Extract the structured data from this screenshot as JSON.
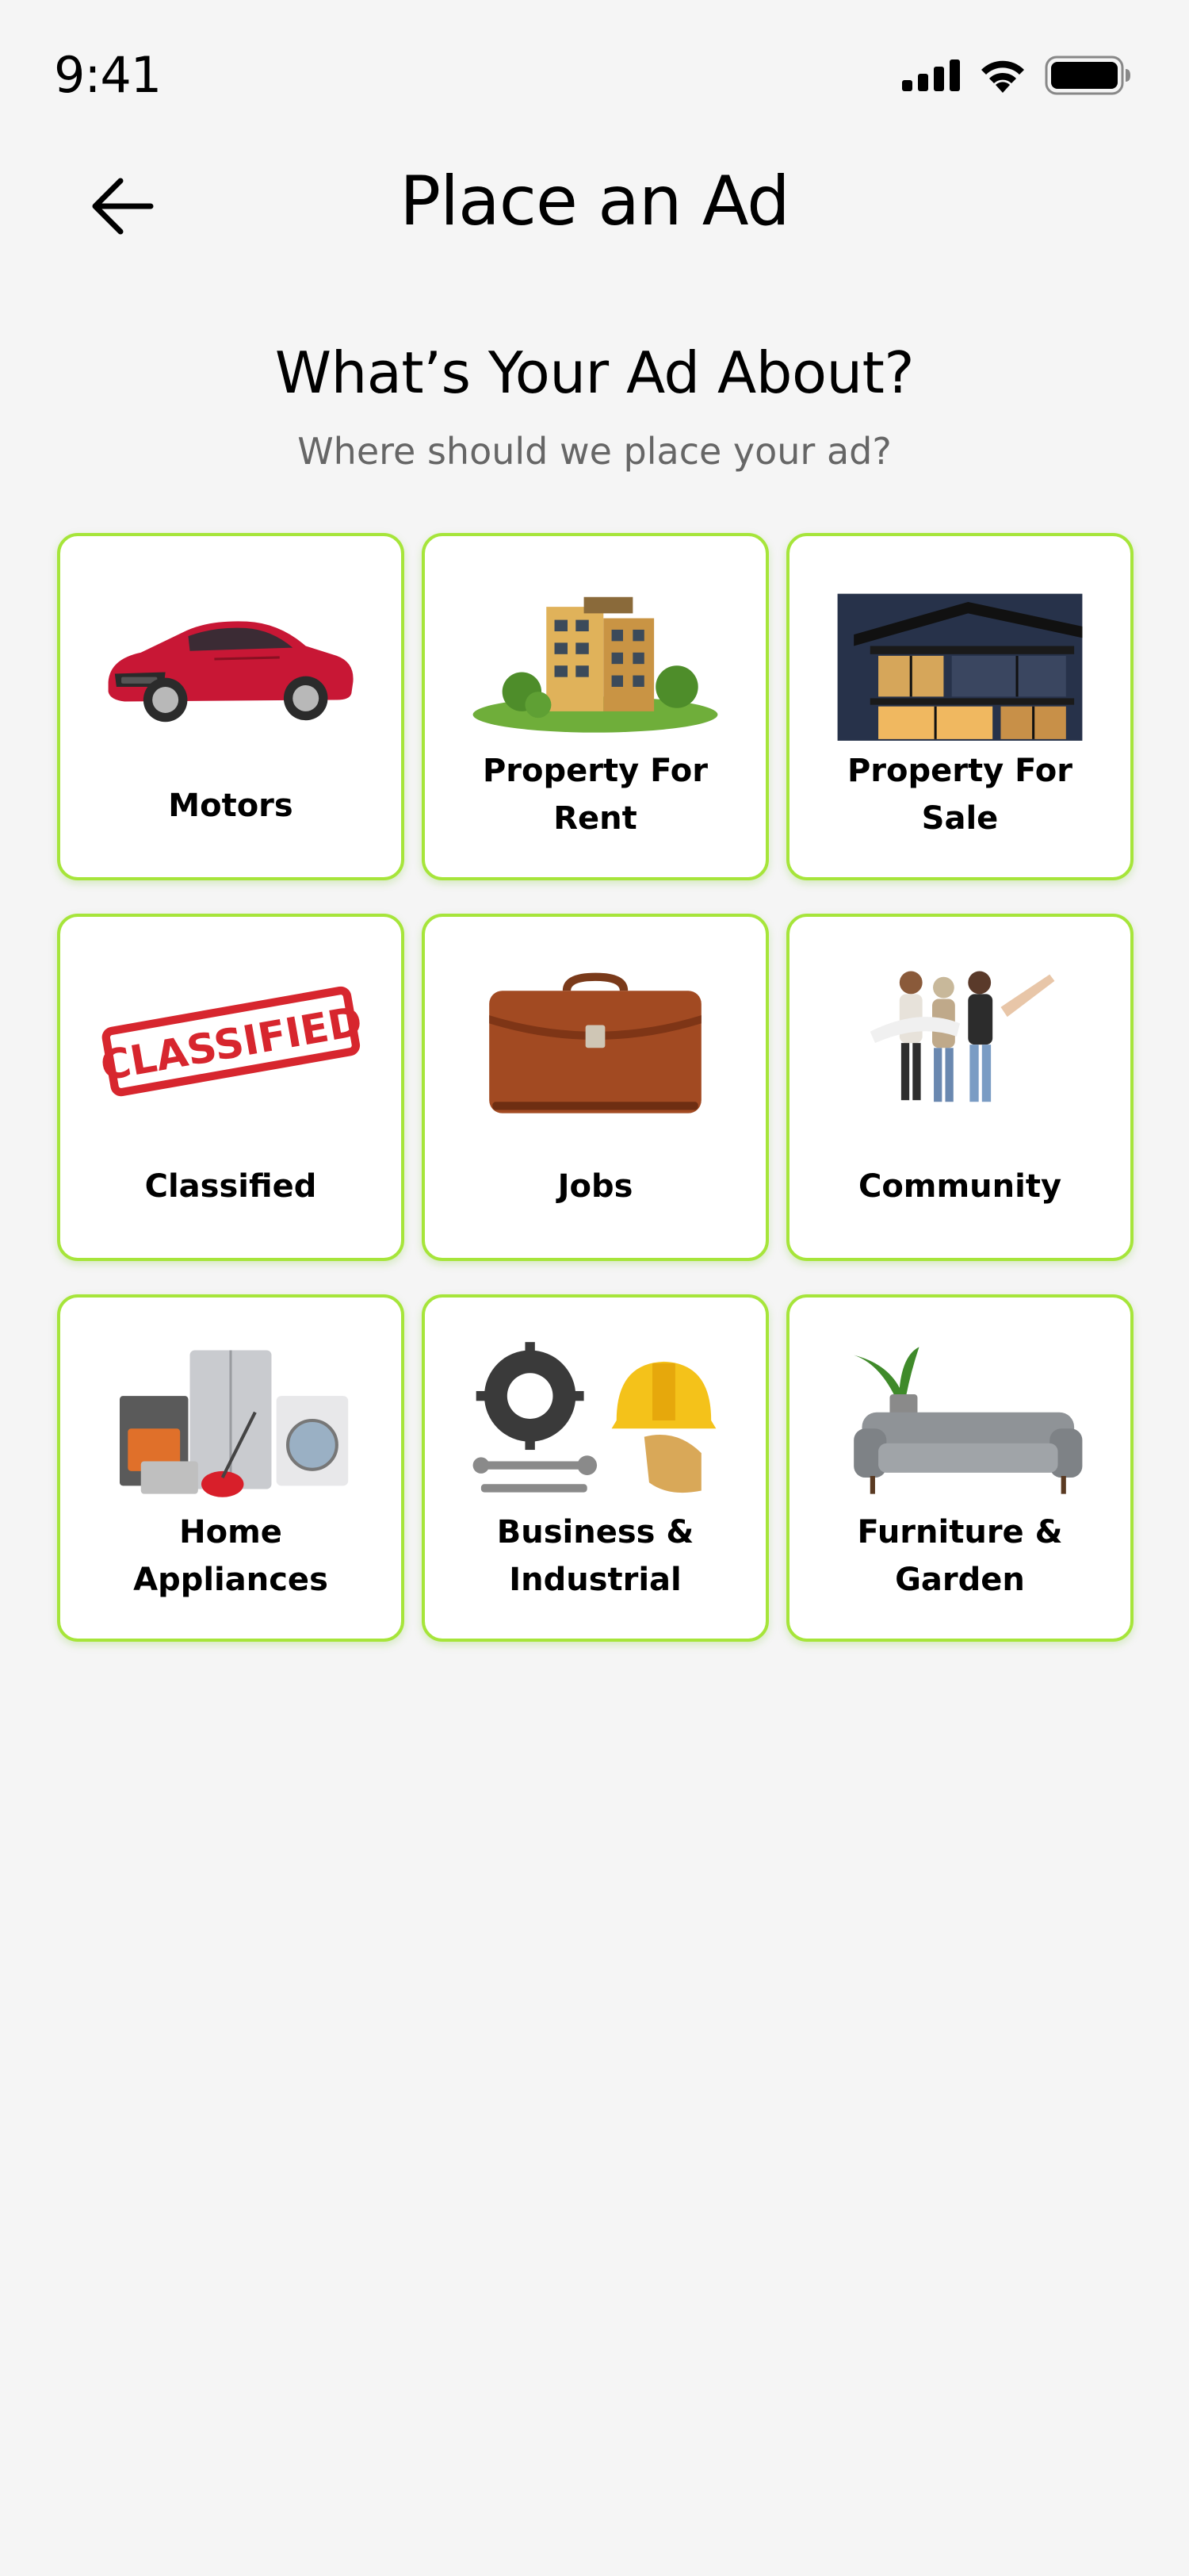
{
  "status_bar": {
    "time": "9:41",
    "icons": [
      "signal-icon",
      "wifi-icon",
      "battery-icon"
    ]
  },
  "header": {
    "back_icon": "arrow-left-icon",
    "title": "Place an Ad"
  },
  "intro": {
    "heading": "What’s Your Ad About?",
    "subheading": "Where should we place your ad?"
  },
  "categories": [
    {
      "label": "Motors",
      "image": "red-car"
    },
    {
      "label": "Property For\nRent",
      "image": "apartment-building"
    },
    {
      "label": "Property For\nSale",
      "image": "modern-house"
    },
    {
      "label": "Classified",
      "image": "classified-stamp",
      "stamp_text": "CLASSIFIED"
    },
    {
      "label": "Jobs",
      "image": "leather-briefcase"
    },
    {
      "label": "Community",
      "image": "group-of-people"
    },
    {
      "label": "Home\nAppliances",
      "image": "home-appliances"
    },
    {
      "label": "Business &\nIndustrial",
      "image": "gear-wrench-hardhat"
    },
    {
      "label": "Furniture &\nGarden",
      "image": "sofa-and-plant"
    }
  ],
  "colors": {
    "card_border": "#a6e53a",
    "background": "#f5f5f5",
    "subtext": "#666666"
  }
}
